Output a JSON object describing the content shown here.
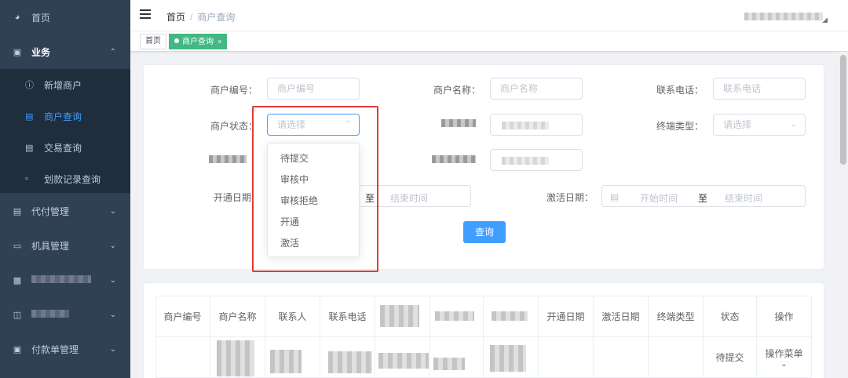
{
  "sidebar": {
    "items": [
      {
        "icon": "dashboard-icon",
        "label": "首页"
      },
      {
        "icon": "briefcase-icon",
        "label": "业务"
      },
      {
        "icon": "card-icon",
        "label": "代付管理"
      },
      {
        "icon": "device-icon",
        "label": "机具管理"
      },
      {
        "icon": "folder-icon",
        "label": ""
      },
      {
        "icon": "database-icon",
        "label": ""
      },
      {
        "icon": "wallet-icon",
        "label": "付款单管理"
      }
    ],
    "submenu": [
      {
        "icon": "info-icon",
        "label": "新增商户"
      },
      {
        "icon": "list-icon",
        "label": "商户查询"
      },
      {
        "icon": "card-icon",
        "label": "交易查询"
      },
      {
        "icon": "clipboard-icon",
        "label": "划款记录查询"
      }
    ]
  },
  "header": {
    "breadcrumb_home": "首页",
    "breadcrumb_sep": "/",
    "breadcrumb_current": "商户查询"
  },
  "tags": {
    "home": "首页",
    "current": "商户查询",
    "close": "×"
  },
  "form": {
    "merchant_no_label": "商户编号：",
    "merchant_no_placeholder": "商户编号",
    "merchant_name_label": "商户名称：",
    "merchant_name_placeholder": "商户名称",
    "phone_label": "联系电话：",
    "phone_placeholder": "联系电话",
    "status_label": "商户状态：",
    "status_placeholder": "请选择",
    "terminal_type_label": "终端类型：",
    "terminal_type_placeholder": "请选择",
    "open_date_label": "开通日期",
    "activate_date_label": "激活日期：",
    "range_to": "至",
    "start_placeholder": "开始时间",
    "end_placeholder": "结束时间",
    "search_button": "查询"
  },
  "dropdown": {
    "options": [
      "待提交",
      "审核中",
      "审核拒绝",
      "开通",
      "激活"
    ]
  },
  "table": {
    "headers": [
      "商户编号",
      "商户名称",
      "联系人",
      "联系电话",
      "",
      "",
      "",
      "开通日期",
      "激活日期",
      "终端类型",
      "状态",
      "操作"
    ],
    "row1": {
      "status": "待提交",
      "action": "操作菜单"
    }
  },
  "colors": {
    "sidebar_bg": "#304156",
    "submenu_bg": "#1f2d3d",
    "accent": "#409eff",
    "tag_active": "#42b983",
    "highlight": "#e53935"
  }
}
